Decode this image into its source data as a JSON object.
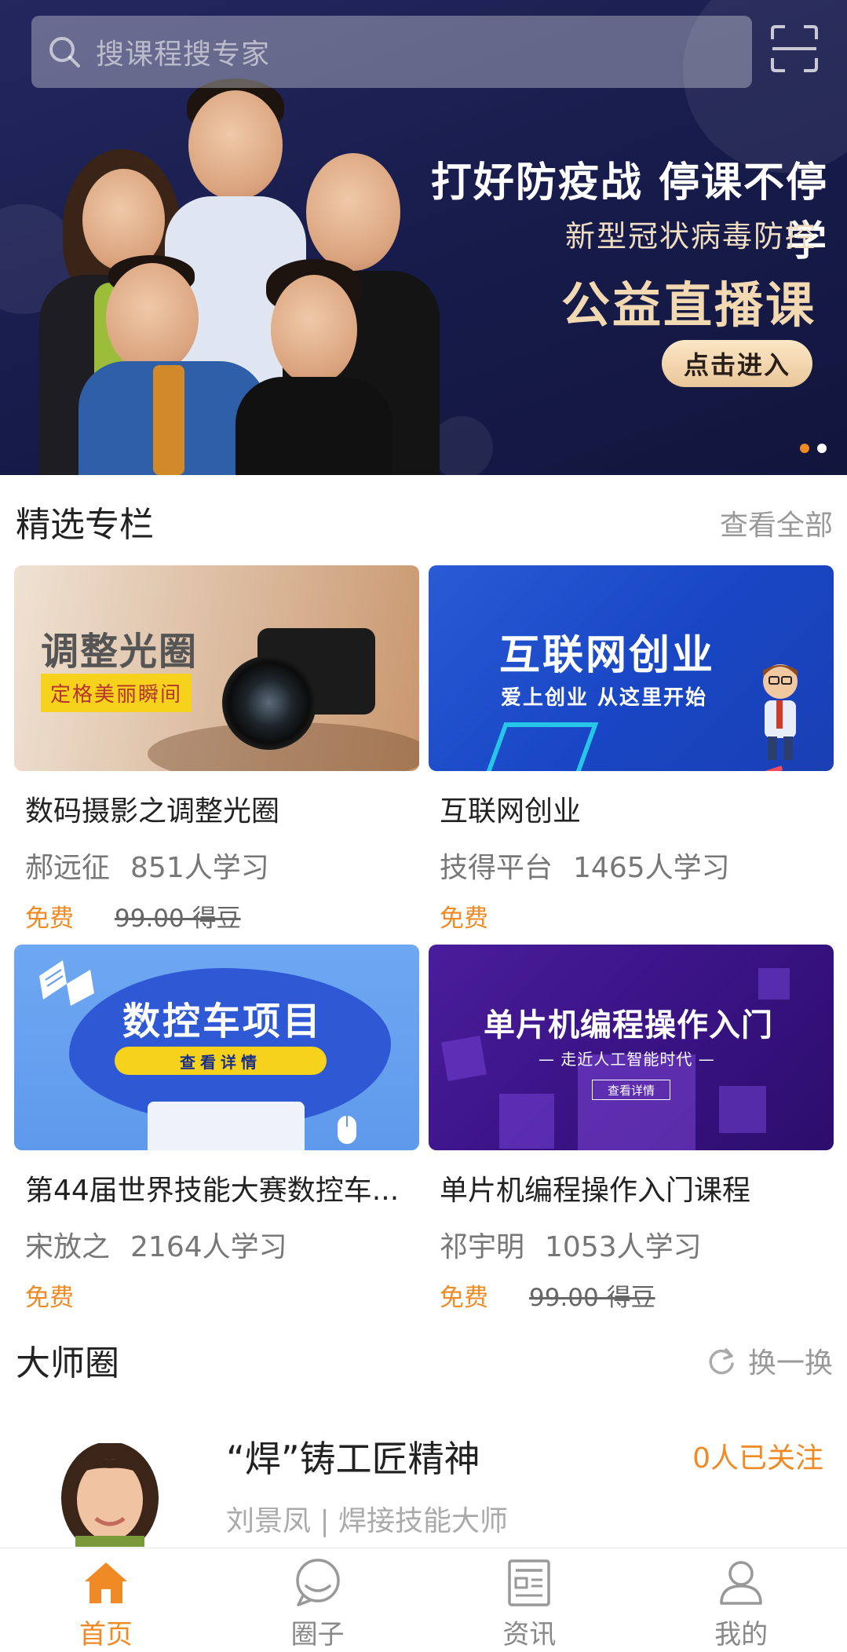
{
  "search": {
    "placeholder": "搜课程搜专家"
  },
  "banner": {
    "headline": "打好防疫战 停课不停学",
    "subline": "新型冠状病毒防控",
    "big": "公益直播课",
    "cta": "点击进入",
    "dots": 2,
    "active_dot": 0
  },
  "featured": {
    "title": "精选专栏",
    "more": "查看全部",
    "courses": [
      {
        "title": "数码摄影之调整光圈",
        "author": "郝远征",
        "learners": "851人学习",
        "price": "免费",
        "original_price": "99.00 得豆",
        "thumb": {
          "text": "调整光圈",
          "tag": "定格美丽瞬间"
        }
      },
      {
        "title": "互联网创业",
        "author": "技得平台",
        "learners": "1465人学习",
        "price": "免费",
        "original_price": "",
        "thumb": {
          "text": "互联网创业",
          "sub": "爱上创业  从这里开始"
        }
      },
      {
        "title": "第44届世界技能大赛数控车...",
        "author": "宋放之",
        "learners": "2164人学习",
        "price": "免费",
        "original_price": "",
        "thumb": {
          "text": "数控车项目",
          "pill": "查看详情"
        }
      },
      {
        "title": "单片机编程操作入门课程",
        "author": "祁宇明",
        "learners": "1053人学习",
        "price": "免费",
        "original_price": "99.00 得豆",
        "thumb": {
          "text": "单片机编程操作入门",
          "sub": "— 走近人工智能时代 —",
          "btn": "查看详情"
        }
      }
    ]
  },
  "masters": {
    "title": "大师圈",
    "refresh": "换一换",
    "items": [
      {
        "title": "“焊”铸工匠精神",
        "followers": "0人已关注",
        "subtitle": "刘景凤 | 焊接技能大师"
      }
    ]
  },
  "tabbar": {
    "tabs": [
      {
        "label": "首页",
        "icon": "home-icon",
        "active": true
      },
      {
        "label": "圈子",
        "icon": "chat-bubble-icon",
        "active": false
      },
      {
        "label": "资讯",
        "icon": "news-icon",
        "active": false
      },
      {
        "label": "我的",
        "icon": "user-icon",
        "active": false
      }
    ]
  },
  "colors": {
    "accent": "#f08a24",
    "banner_bg": "#1a1e4f"
  }
}
